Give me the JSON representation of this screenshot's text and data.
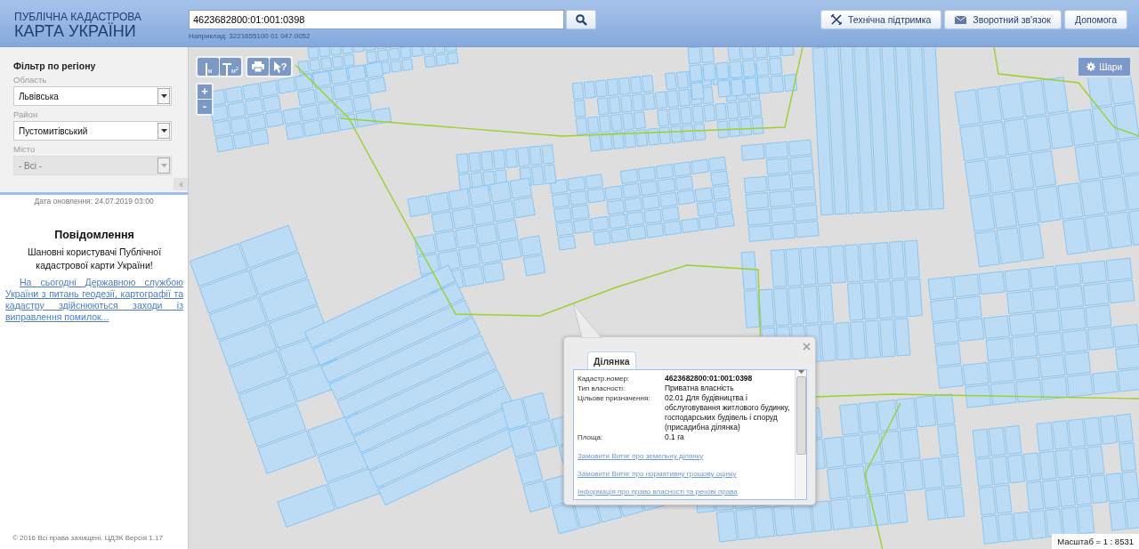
{
  "header": {
    "logo_line1": "ПУБЛІЧНА КАДАСТРОВА",
    "logo_line2": "КАРТА УКРАЇНИ",
    "search": {
      "value": "4623682800:01:001:0398",
      "hint": "Наприклад: 3221655100 01 047.0052"
    },
    "buttons": [
      {
        "label": "Технічна підтримка",
        "kind": "tools"
      },
      {
        "label": "Зворотний зв'язок",
        "kind": "mail"
      },
      {
        "label": "Допомога",
        "kind": "plain"
      }
    ]
  },
  "sidebar": {
    "filter": {
      "title": "Фільтр по регіону",
      "fields": [
        {
          "label": "Область",
          "value": "Львівська",
          "disabled": false
        },
        {
          "label": "Район",
          "value": "Пустомитівський",
          "disabled": false
        },
        {
          "label": "Місто",
          "value": "- Всі -",
          "disabled": true
        }
      ]
    },
    "update_date": "Дата оновлення: 24.07.2019 03:00",
    "notice": {
      "title": "Повідомлення",
      "text": "Шановні користувачі Публічної кадастрової карти України!",
      "link": "На сьогодні Державною службою України з питань геодезії, картографії та кадастру здійснюються заходи із виправлення помилок..."
    },
    "copyright": "© 2016 Всі права захищені. ЦДЗК Версія 1.17"
  },
  "map": {
    "tools": [
      {
        "kind": "length",
        "label": "м"
      },
      {
        "kind": "area",
        "label": "м$^{2}$"
      },
      {
        "kind": "print"
      },
      {
        "kind": "identify",
        "label": "?"
      }
    ],
    "zoom": [
      "+",
      "-"
    ],
    "layers_button": "Шари",
    "scale": "Масштаб = 1 : 8531",
    "popup": {
      "tabs": [
        {
          "label": "Ділянка",
          "selected": true
        }
      ],
      "fields": [
        {
          "label": "Кадастр.номер:",
          "value": "4623682800:01:001:0398",
          "bold": true
        },
        {
          "label": "Тип власності:",
          "value": "Приватна власність",
          "bold": false
        },
        {
          "label": "Цільове призначення:",
          "value": "02.01 Для будівництва і обслуговування житлового будинку, господарських будівель і споруд (присадибна ділянка)",
          "bold": false
        },
        {
          "label": "Площа:",
          "value": "0.1 га",
          "bold": false
        }
      ],
      "links": [
        "Замовити Витяг про земельну ділянку",
        "Замовити Витяг про нормативну грошову оцінку",
        "Інформація про право власності та речові права"
      ]
    }
  }
}
